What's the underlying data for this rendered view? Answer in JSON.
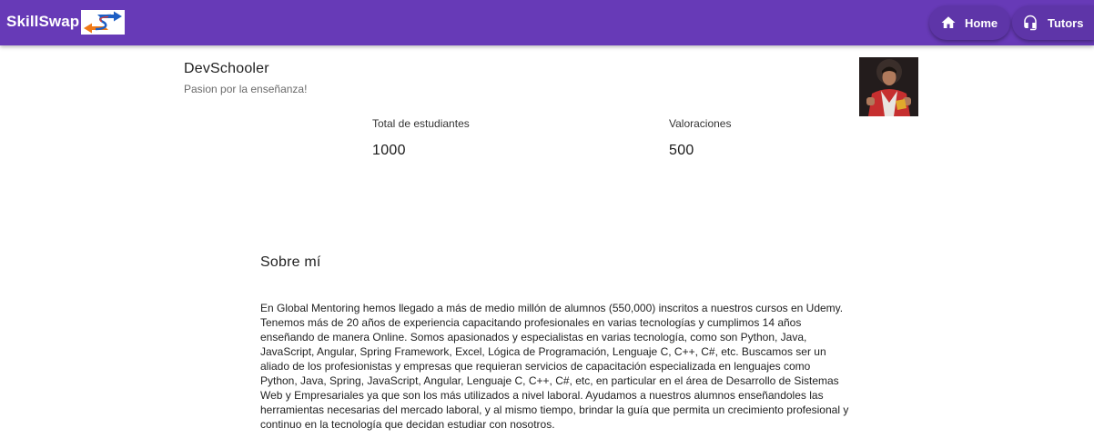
{
  "header": {
    "brand": "SkillSwap",
    "logo_icon": "skillswap-swap-arrows-logo",
    "background_color": "#673ab7",
    "nav": [
      {
        "label": "Home",
        "icon": "home-icon"
      },
      {
        "label": "Tutors",
        "icon": "headset-icon"
      }
    ]
  },
  "profile": {
    "name": "DevSchooler",
    "tagline": "Pasion por la enseñanza!",
    "avatar_icon": "tutor-avatar"
  },
  "stats": [
    {
      "label": "Total de estudiantes",
      "value": "1000"
    },
    {
      "label": "Valoraciones",
      "value": "500"
    }
  ],
  "about": {
    "title": "Sobre mí",
    "text": "En Global Mentoring hemos llegado a más de medio millón de alumnos (550,000) inscritos a nuestros cursos en Udemy. Tenemos más de 20 años de experiencia capacitando profesionales en varias tecnologías y cumplimos 14 años enseñando de manera Online. Somos apasionados y especialistas en varias tecnología, como son Python, Java, JavaScript, Angular, Spring Framework, Excel, Lógica de Programación, Lenguaje C, C++, C#, etc. Buscamos ser un aliado de los profesionistas y empresas que requieran servicios de capacitación especializada en lenguajes como Python, Java, Spring, JavaScript, Angular, Lenguaje C, C++, C#, etc, en particular en el área de Desarrollo de Sistemas Web y Empresariales ya que son los más utilizados a nivel laboral. Ayudamos a nuestros alumnos enseñandoles las herramientas necesarias del mercado laboral, y al mismo tiempo, brindar la guía que permita un crecimiento profesional y continuo en la tecnología que decidan estudiar con nosotros."
  }
}
